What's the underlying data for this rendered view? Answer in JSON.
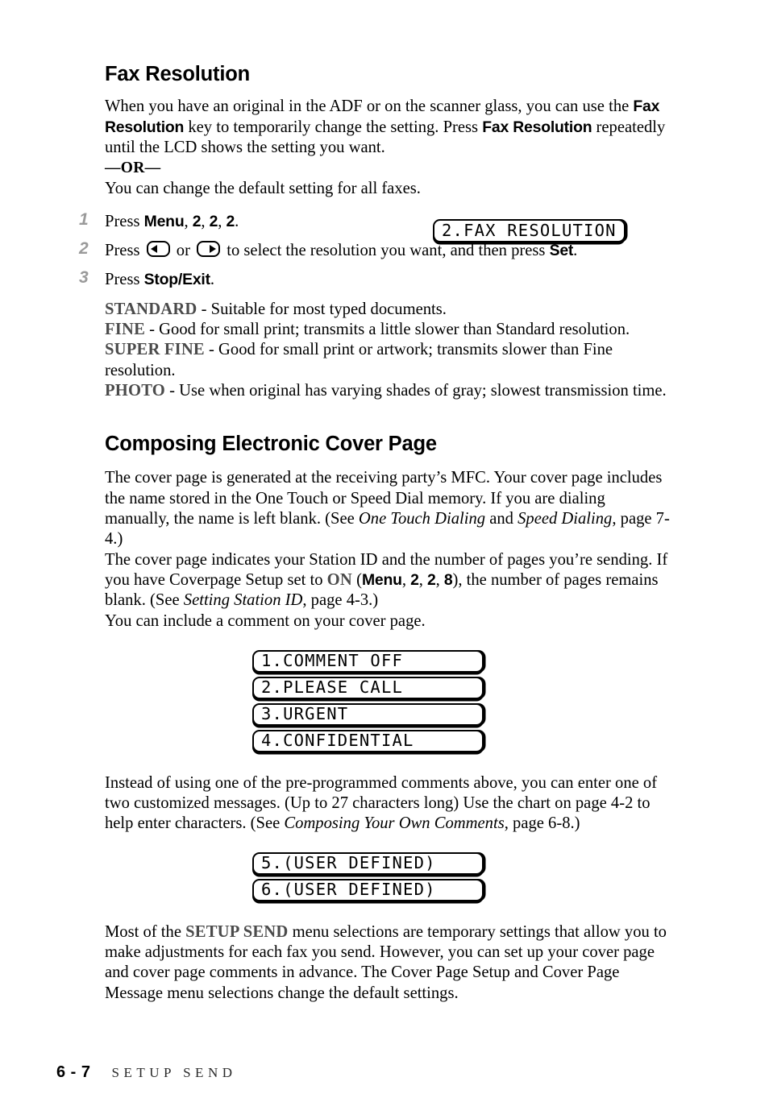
{
  "document": {
    "footer": {
      "page_number": "6 - 7",
      "chapter_label": "SETUP SEND"
    }
  },
  "fax_resolution": {
    "heading": "Fax Resolution",
    "intro": {
      "p1_a": "When you have an original in the ADF or on the scanner glass, you can use the ",
      "key1": "Fax Resolution",
      "p1_b": " key to temporarily change the setting. Press ",
      "key2": "Fax Resolution",
      "p1_c": " repeatedly until the LCD shows the setting you want.",
      "or": "—OR—",
      "p2": "You can change the default setting for all faxes."
    },
    "steps": [
      {
        "number": "1",
        "text_a": "Press ",
        "key": "Menu",
        "text_b": ", ",
        "digit1": "2",
        "sep1": ", ",
        "digit2": "2",
        "sep2": ", ",
        "digit3": "2",
        "text_c": "."
      },
      {
        "number": "2",
        "text_a": "Press ",
        "left_key_icon": "arrow-left-key",
        "text_b": " or ",
        "right_key_icon": "arrow-right-key",
        "text_c": " to select the resolution you want, and then press ",
        "key": "Set",
        "text_d": "."
      },
      {
        "number": "3",
        "text_a": "Press ",
        "key": "Stop/Exit",
        "text_b": "."
      }
    ],
    "lcd_display": "2.FAX RESOLUTION",
    "definitions": [
      {
        "term": "STANDARD",
        "description": " - Suitable for most typed documents."
      },
      {
        "term": "FINE",
        "description": " - Good for small print; transmits a little slower than Standard resolution."
      },
      {
        "term": "SUPER FINE",
        "description": " - Good for small print or artwork; transmits slower than Fine resolution."
      },
      {
        "term": "PHOTO",
        "description": " - Use when original has varying shades of gray; slowest transmission time."
      }
    ]
  },
  "cover_page": {
    "heading": "Composing Electronic Cover Page",
    "para1": {
      "a": "The cover page is generated at the receiving party’s MFC. Your cover page includes the name stored in the One Touch or Speed Dial memory. If you are dialing manually, the name is left blank. (See ",
      "ref1": "One Touch Dialing",
      "b": " and ",
      "ref2": "Speed Dialing",
      "c": ", page 7-4.)"
    },
    "para2": {
      "a": "The cover page indicates your Station ID and the number of pages you’re sending. If you have Coverpage Setup set to ",
      "on": "ON",
      "b": " (",
      "key": "Menu",
      "c": ", ",
      "digit1": "2",
      "d": ", ",
      "digit2": "2",
      "e": ", ",
      "digit3": "8",
      "f": "), the number of pages remains blank. (See ",
      "ref": "Setting Station ID",
      "g": ", page 4-3.)"
    },
    "para3": "You can include a comment on your cover page.",
    "comment_options": [
      "1.COMMENT OFF",
      "2.PLEASE CALL",
      "3.URGENT",
      "4.CONFIDENTIAL"
    ],
    "para4": {
      "a": "Instead of using one of the pre-programmed comments above, you can enter one of two customized messages. (Up to 27 characters long) Use the chart on page 4-2 to help enter characters. (See ",
      "ref": "Composing Your Own Comments",
      "b": ", page 6-8.)"
    },
    "user_defined_options": [
      "5.(USER DEFINED)",
      "6.(USER DEFINED)"
    ],
    "para5": {
      "a": "Most of the ",
      "term": "SETUP SEND",
      "b": " menu selections are temporary settings that allow you to make adjustments for each fax you send. However, you can set up your cover page and cover page comments in advance. The Cover Page Setup and Cover Page Message menu selections change the default settings."
    }
  }
}
